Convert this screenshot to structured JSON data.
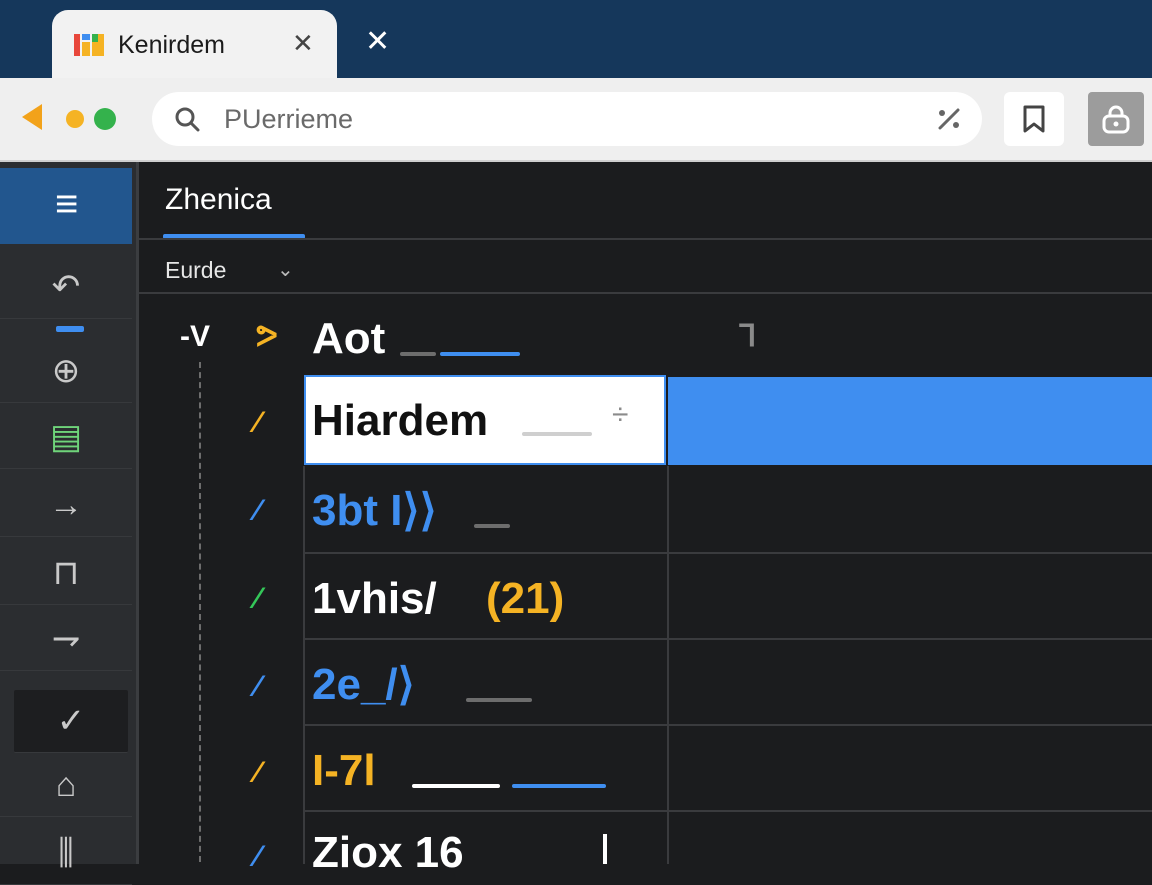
{
  "browser": {
    "tab_title": "Kenirdem",
    "tab_close": "✕",
    "window_close": "✕",
    "url_placeholder": "PUerrieme"
  },
  "sidebar": {
    "items": [
      {
        "icon": "undo-icon",
        "glyph": "↶"
      },
      {
        "icon": "package-icon",
        "glyph": "⊕"
      },
      {
        "icon": "note-icon",
        "glyph": "▤"
      },
      {
        "icon": "arrow-right-icon",
        "glyph": "→"
      },
      {
        "icon": "plug-icon",
        "glyph": "⊓"
      },
      {
        "icon": "terminal-icon",
        "glyph": "⇁"
      },
      {
        "icon": "check-icon",
        "glyph": "✓"
      },
      {
        "icon": "lock-icon",
        "glyph": "⌂"
      },
      {
        "icon": "bars-icon",
        "glyph": "⫼"
      }
    ]
  },
  "panel": {
    "tab_label": "Zhenica",
    "filter_label": "Eurde",
    "filter_chevron": "⌄"
  },
  "tree": {
    "root": {
      "expander": "-V",
      "marker": "ᕗ",
      "label": "Aot",
      "right_icon": "ᒣ"
    },
    "rows": [
      {
        "marker": "⁄",
        "marker_color": "#f5b324",
        "label": "Hiardem",
        "label_color": "#111111",
        "selected": true,
        "spinner": "÷"
      },
      {
        "marker": "⁄",
        "marker_color": "#3f8ef0",
        "label": "3bt I⟩⟩",
        "label_color": "#3f8ef0"
      },
      {
        "marker": "⁄",
        "marker_color": "#34c759",
        "label": "1vhis/",
        "label_color": "#ffffff",
        "label_tail": "(21)",
        "tail_color": "#f5b324"
      },
      {
        "marker": "⁄",
        "marker_color": "#3f8ef0",
        "label": "2e_/⟩",
        "label_color": "#3f8ef0"
      },
      {
        "marker": "⁄",
        "marker_color": "#f5b324",
        "label": "I-7l",
        "label_color": "#f5b324"
      },
      {
        "marker": "⁄",
        "marker_color": "#3f8ef0",
        "label": "Ziox 16",
        "label_color": "#ffffff"
      }
    ]
  },
  "colors": {
    "accent": "#3f8ef0",
    "titlebar": "#15375b",
    "warning": "#f5b324",
    "success": "#34c759"
  }
}
